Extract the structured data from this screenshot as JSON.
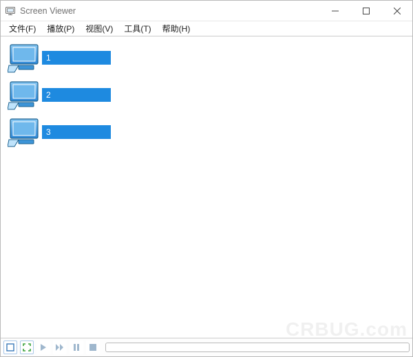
{
  "titlebar": {
    "title": "Screen Viewer"
  },
  "menubar": {
    "items": [
      {
        "label": "文件(F)"
      },
      {
        "label": "播放(P)"
      },
      {
        "label": "视图(V)"
      },
      {
        "label": "工具(T)"
      },
      {
        "label": "帮助(H)"
      }
    ]
  },
  "devices": [
    {
      "label": "1"
    },
    {
      "label": "2"
    },
    {
      "label": "3"
    }
  ],
  "toolbar": {
    "progress": 0
  },
  "watermark": "CRBUG.com"
}
